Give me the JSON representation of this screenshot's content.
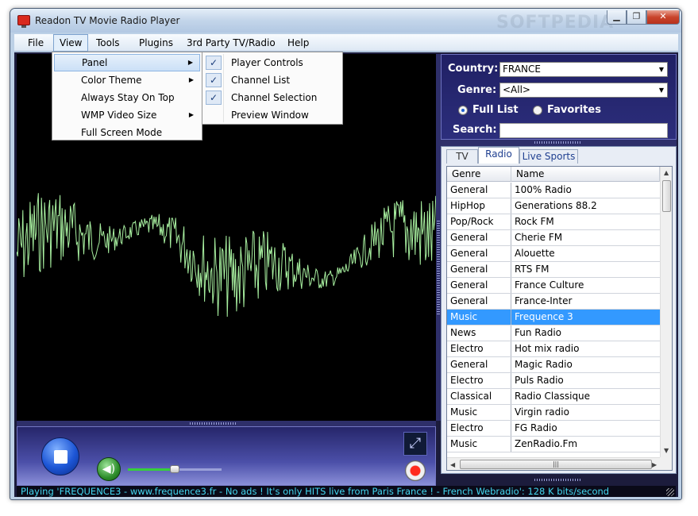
{
  "window": {
    "title": "Readon TV Movie Radio Player",
    "watermark": "SOFTPEDIA"
  },
  "window_controls": {
    "minimize": "▁",
    "maximize": "❐",
    "close": "✕"
  },
  "menu": [
    "File",
    "View",
    "Tools",
    "Plugins",
    "3rd Party TV/Radio",
    "Help"
  ],
  "view_menu": [
    "Panel",
    "Color Theme",
    "Always Stay On Top",
    "WMP Video Size",
    "Full Screen Mode"
  ],
  "panel_menu": [
    {
      "label": "Player Controls",
      "checked": true
    },
    {
      "label": "Channel List",
      "checked": true
    },
    {
      "label": "Channel Selection",
      "checked": true
    },
    {
      "label": "Preview Window",
      "checked": false
    }
  ],
  "search": {
    "country_label": "Country:",
    "country_value": "FRANCE",
    "genre_label": "Genre:",
    "genre_value": "<All>",
    "full_list_label": "Full List",
    "favorites_label": "Favorites",
    "search_label": "Search:",
    "search_value": ""
  },
  "tabs": [
    "TV",
    "Radio",
    "Live Sports"
  ],
  "active_tab": "Radio",
  "channel_table": {
    "headers": [
      "Genre",
      "Name"
    ],
    "rows": [
      [
        "General",
        "100% Radio"
      ],
      [
        "HipHop",
        "Generations 88.2"
      ],
      [
        "Pop/Rock",
        "Rock FM"
      ],
      [
        "General",
        "Cherie FM"
      ],
      [
        "General",
        "Alouette"
      ],
      [
        "General",
        "RTS FM"
      ],
      [
        "General",
        "France Culture"
      ],
      [
        "General",
        "France-Inter"
      ],
      [
        "Music",
        "Frequence 3"
      ],
      [
        "News",
        "Fun Radio"
      ],
      [
        "Electro",
        "Hot mix radio"
      ],
      [
        "General",
        "Magic Radio"
      ],
      [
        "Electro",
        "Puls Radio"
      ],
      [
        "Classical",
        "Radio Classique"
      ],
      [
        "Music",
        "Virgin radio"
      ],
      [
        "Electro",
        "FG Radio"
      ],
      [
        "Music",
        "ZenRadio.Fm"
      ]
    ],
    "selected_row": 8
  },
  "player": {
    "volume_fraction": 0.5
  },
  "status": {
    "text": "Playing 'FREQUENCE3 - www.frequence3.fr - No ads ! It's only HITS live from Paris France ! - French Webradio': 128 K bits/second"
  },
  "colors": {
    "waveform": "#a8f0a0",
    "status_text": "#43d7ef",
    "selection": "#3399ff",
    "panel_bg": "#202064"
  },
  "icons": {
    "stop": "stop-icon",
    "volume": "speaker-icon",
    "fullscreen": "fullscreen-icon",
    "record": "record-icon",
    "check": "✓",
    "submenu": "▶",
    "dropdown": "▼",
    "scroll_up": "▲",
    "scroll_down": "▼",
    "scroll_left": "◀",
    "scroll_right": "▶",
    "thumb_grip": "|||",
    "fs_glyph": "⤢",
    "vol_glyph": "◀)"
  }
}
